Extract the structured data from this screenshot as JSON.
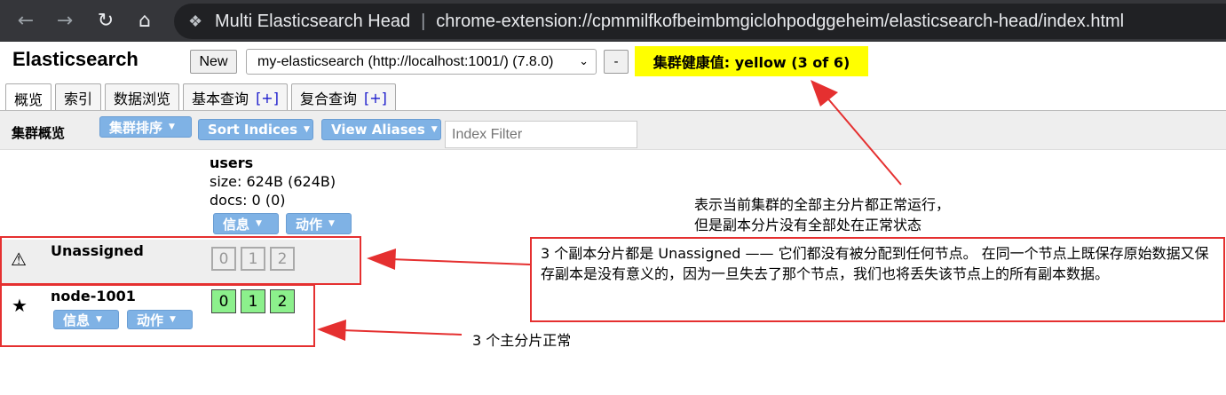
{
  "browser": {
    "page_title": "Multi Elasticsearch Head",
    "url": "chrome-extension://cpmmilfkofbeimbmgiclohpodggeheim/elasticsearch-head/index.html"
  },
  "header": {
    "app_title": "Elasticsearch",
    "new_button": "New",
    "cluster_selected": "my-elasticsearch (http://localhost:1001/) (7.8.0)",
    "remove_button": "-",
    "health": "集群健康值: yellow (3 of 6)"
  },
  "tabs": [
    {
      "label": "概览",
      "plus": ""
    },
    {
      "label": "索引",
      "plus": ""
    },
    {
      "label": "数据浏览",
      "plus": ""
    },
    {
      "label": "基本查询",
      "plus": "[+]"
    },
    {
      "label": "复合查询",
      "plus": "[+]"
    }
  ],
  "toolbar": {
    "label": "集群概览",
    "sort_cluster": "集群排序",
    "sort_indices": "Sort Indices",
    "view_aliases": "View Aliases",
    "index_filter_placeholder": "Index Filter"
  },
  "index": {
    "name": "users",
    "size": "size: 624B (624B)",
    "docs": "docs: 0 (0)",
    "info_button": "信息",
    "action_button": "动作"
  },
  "rows": {
    "unassigned": {
      "name": "Unassigned",
      "shards": [
        "0",
        "1",
        "2"
      ]
    },
    "node": {
      "name": "node-1001",
      "info_button": "信息",
      "action_button": "动作",
      "shards": [
        "0",
        "1",
        "2"
      ]
    }
  },
  "annotations": {
    "health_note_line1": "表示当前集群的全部主分片都正常运行，",
    "health_note_line2": "但是副本分片没有全部处在正常状态",
    "replica_note": "3 个副本分片都是 Unassigned —— 它们都没有被分配到任何节点。 在同一个节点上既保存原始数据又保存副本是没有意义的，因为一旦失去了那个节点，我们也将丢失该节点上的所有副本数据。",
    "primary_note": "3 个主分片正常"
  },
  "colors": {
    "health_yellow": "#ffff00",
    "shard_started": "#8cf08c",
    "button_blue": "#7fb2e5",
    "annotation_red": "#e53030"
  }
}
